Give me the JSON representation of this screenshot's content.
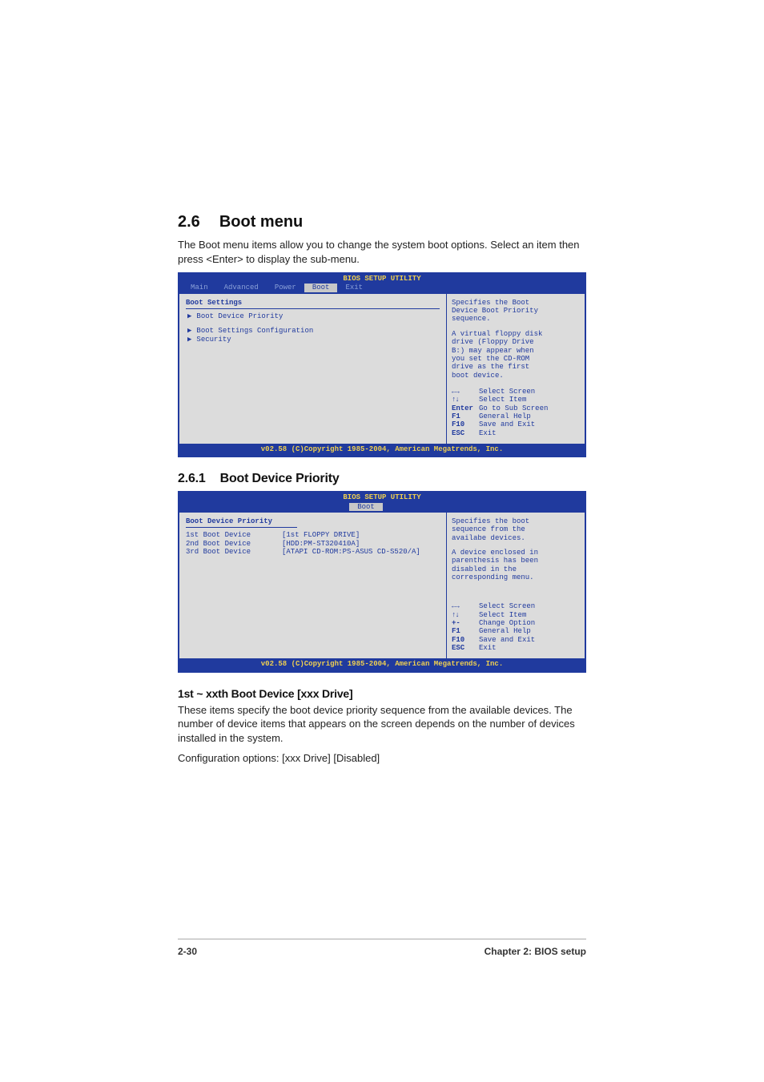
{
  "heading": {
    "num": "2.6",
    "title": "Boot menu"
  },
  "intro": "The Boot menu items allow you to change the system boot options. Select an item then press <Enter> to display the sub-menu.",
  "bios1": {
    "title": "BIOS SETUP UTILITY",
    "tabs": {
      "t0": "Main",
      "t1": "Advanced",
      "t2": "Power",
      "t3": "Boot",
      "t4": "Exit"
    },
    "left_title": "Boot Settings",
    "items": {
      "i0": "Boot Device Priority",
      "i1": "Boot Settings Configuration",
      "i2": "Security"
    },
    "right": {
      "l0": "Specifies the Boot",
      "l1": "Device Boot Priority",
      "l2": "sequence.",
      "l3": "A virtual floppy disk",
      "l4": "drive (Floppy Drive",
      "l5": "B:) may appear when",
      "l6": "you set the CD-ROM",
      "l7": "drive as the first",
      "l8": "boot device."
    },
    "keys": {
      "k0k": "←→",
      "k0v": "Select Screen",
      "k1k": "↑↓",
      "k1v": "Select Item",
      "k2k": "Enter",
      "k2v": "Go to Sub Screen",
      "k3k": "F1",
      "k3v": "General Help",
      "k4k": "F10",
      "k4v": "Save and Exit",
      "k5k": "ESC",
      "k5v": "Exit"
    },
    "footer": "v02.58 (C)Copyright 1985-2004, American Megatrends, Inc."
  },
  "sub": {
    "num": "2.6.1",
    "title": "Boot Device Priority"
  },
  "bios2": {
    "title": "BIOS SETUP UTILITY",
    "tab": "Boot",
    "left_title": "Boot Device Priority",
    "devices": {
      "d0l": "1st Boot Device",
      "d0v": "[1st FLOPPY DRIVE]",
      "d1l": "2nd Boot Device",
      "d1v": "[HDD:PM-ST320410A]",
      "d2l": "3rd Boot Device",
      "d2v": "[ATAPI CD-ROM:PS-ASUS CD-S520/A]"
    },
    "right": {
      "l0": "Specifies the boot",
      "l1": "sequence from the",
      "l2": "availabe devices.",
      "l3": "A device enclosed in",
      "l4": "parenthesis has been",
      "l5": "disabled in the",
      "l6": "corresponding menu."
    },
    "keys": {
      "k0k": "←→",
      "k0v": "Select Screen",
      "k1k": "↑↓",
      "k1v": "Select Item",
      "k2k": "+-",
      "k2v": "Change Option",
      "k3k": "F1",
      "k3v": "General Help",
      "k4k": "F10",
      "k4v": "Save and Exit",
      "k5k": "ESC",
      "k5v": "Exit"
    },
    "footer": "v02.58 (C)Copyright 1985-2004, American Megatrends, Inc."
  },
  "setting_heading": "1st ~ xxth Boot Device [xxx Drive]",
  "setting_body": "These items specify the boot device priority sequence from the available devices. The number of device items that appears on the screen depends on the number of devices installed in the system.",
  "setting_config": "Configuration options: [xxx Drive] [Disabled]",
  "footer": {
    "page": "2-30",
    "chapter": "Chapter 2: BIOS setup"
  }
}
